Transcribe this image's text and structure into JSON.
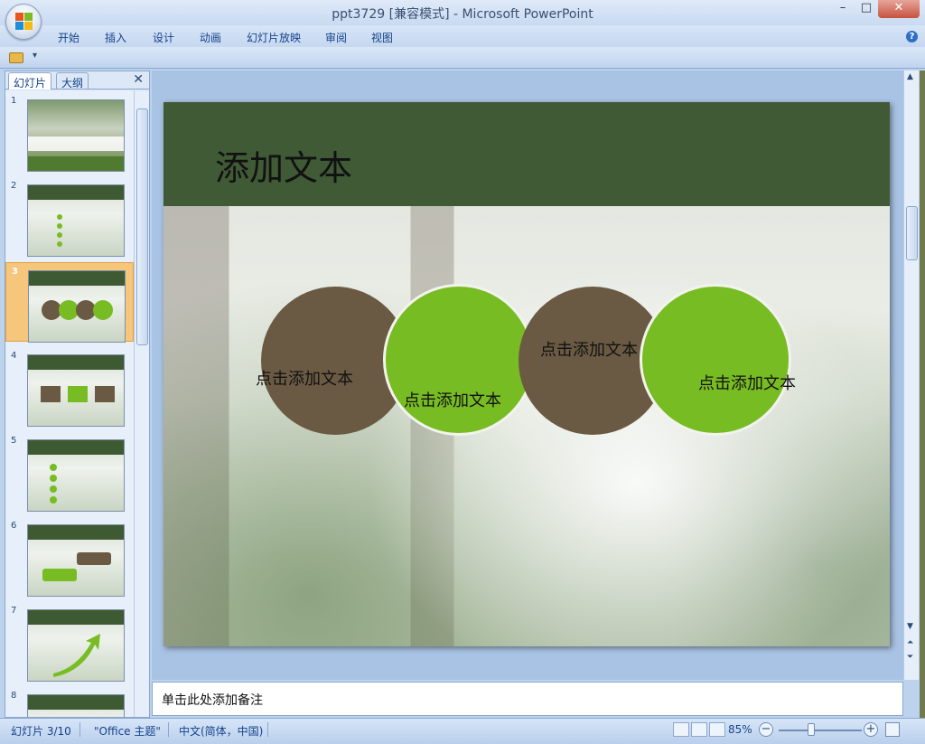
{
  "window": {
    "title": "ppt3729 [兼容模式] - Microsoft PowerPoint",
    "controls": {
      "minimize": "–",
      "maximize": "□",
      "close": "✕"
    }
  },
  "menu": {
    "items": [
      "开始",
      "插入",
      "设计",
      "动画",
      "幻灯片放映",
      "审阅",
      "视图"
    ],
    "help": "?"
  },
  "qat": {
    "dropdown": "▾"
  },
  "left_pane": {
    "tabs": [
      "幻灯片",
      "大纲"
    ],
    "close": "✕",
    "slide_numbers": [
      "1",
      "2",
      "3",
      "4",
      "5",
      "6",
      "7",
      "8"
    ],
    "active_slide": 3
  },
  "slide": {
    "title": "添加文本",
    "circles": [
      {
        "label": "点击添加文本",
        "color": "#6b5a43"
      },
      {
        "label": "点击添加文本",
        "color": "#78bc23"
      },
      {
        "label": "点击添加文本",
        "color": "#6b5a43"
      },
      {
        "label": "点击添加文本",
        "color": "#78bc23"
      }
    ]
  },
  "notes": {
    "placeholder": "单击此处添加备注"
  },
  "status": {
    "slide_indicator": "幻灯片 3/10",
    "theme": "\"Office 主题\"",
    "language": "中文(简体，中国)",
    "zoom": "85%",
    "zoom_out": "−",
    "zoom_in": "+"
  },
  "colors": {
    "header_green": "#405a36",
    "circle_brown": "#6b5a43",
    "circle_green": "#78bc23",
    "ribbon_blue": "#c5d8f0"
  }
}
